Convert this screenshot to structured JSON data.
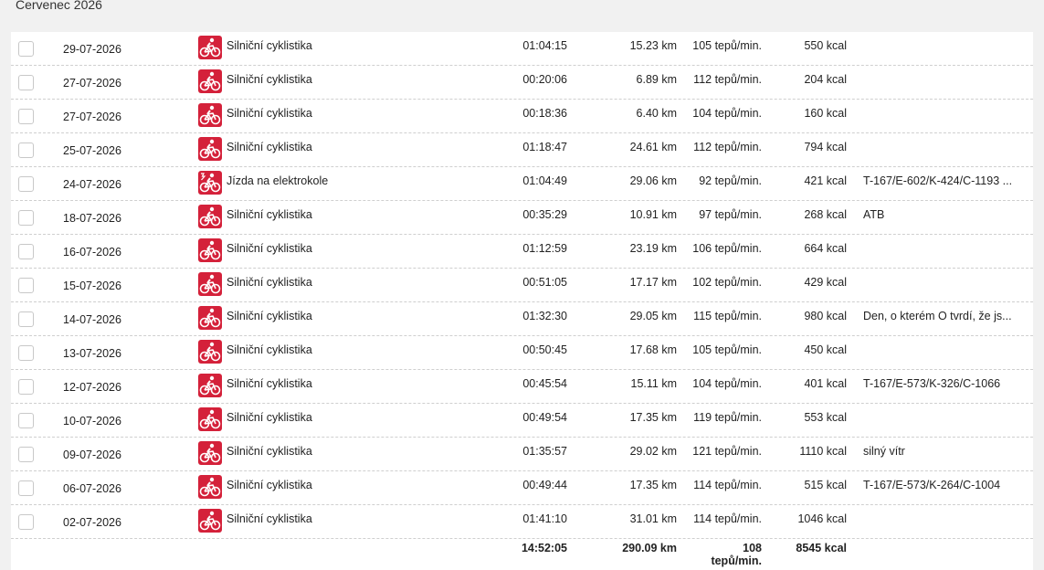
{
  "month_title": "Červenec 2026",
  "rows": [
    {
      "date": "29-07-2026",
      "sport": "Silniční cyklistika",
      "icon": "road-bike-icon",
      "time": "01:04:15",
      "distance": "15.23 km",
      "heart_rate": "105 tepů/min.",
      "kcal": "550 kcal",
      "note": ""
    },
    {
      "date": "27-07-2026",
      "sport": "Silniční cyklistika",
      "icon": "road-bike-icon",
      "time": "00:20:06",
      "distance": "6.89 km",
      "heart_rate": "112 tepů/min.",
      "kcal": "204 kcal",
      "note": ""
    },
    {
      "date": "27-07-2026",
      "sport": "Silniční cyklistika",
      "icon": "road-bike-icon",
      "time": "00:18:36",
      "distance": "6.40 km",
      "heart_rate": "104 tepů/min.",
      "kcal": "160 kcal",
      "note": ""
    },
    {
      "date": "25-07-2026",
      "sport": "Silniční cyklistika",
      "icon": "road-bike-icon",
      "time": "01:18:47",
      "distance": "24.61 km",
      "heart_rate": "112 tepů/min.",
      "kcal": "794 kcal",
      "note": ""
    },
    {
      "date": "24-07-2026",
      "sport": "Jízda na elektrokole",
      "icon": "e-bike-icon",
      "time": "01:04:49",
      "distance": "29.06 km",
      "heart_rate": "92 tepů/min.",
      "kcal": "421 kcal",
      "note": "T-167/E-602/K-424/C-1193 ..."
    },
    {
      "date": "18-07-2026",
      "sport": "Silniční cyklistika",
      "icon": "road-bike-icon",
      "time": "00:35:29",
      "distance": "10.91 km",
      "heart_rate": "97 tepů/min.",
      "kcal": "268 kcal",
      "note": "ATB"
    },
    {
      "date": "16-07-2026",
      "sport": "Silniční cyklistika",
      "icon": "road-bike-icon",
      "time": "01:12:59",
      "distance": "23.19 km",
      "heart_rate": "106 tepů/min.",
      "kcal": "664 kcal",
      "note": ""
    },
    {
      "date": "15-07-2026",
      "sport": "Silniční cyklistika",
      "icon": "road-bike-icon",
      "time": "00:51:05",
      "distance": "17.17 km",
      "heart_rate": "102 tepů/min.",
      "kcal": "429 kcal",
      "note": ""
    },
    {
      "date": "14-07-2026",
      "sport": "Silniční cyklistika",
      "icon": "road-bike-icon",
      "time": "01:32:30",
      "distance": "29.05 km",
      "heart_rate": "115 tepů/min.",
      "kcal": "980 kcal",
      "note": "Den, o kterém O tvrdí, že js..."
    },
    {
      "date": "13-07-2026",
      "sport": "Silniční cyklistika",
      "icon": "road-bike-icon",
      "time": "00:50:45",
      "distance": "17.68 km",
      "heart_rate": "105 tepů/min.",
      "kcal": "450 kcal",
      "note": ""
    },
    {
      "date": "12-07-2026",
      "sport": "Silniční cyklistika",
      "icon": "road-bike-icon",
      "time": "00:45:54",
      "distance": "15.11 km",
      "heart_rate": "104 tepů/min.",
      "kcal": "401 kcal",
      "note": "T-167/E-573/K-326/C-1066"
    },
    {
      "date": "10-07-2026",
      "sport": "Silniční cyklistika",
      "icon": "road-bike-icon",
      "time": "00:49:54",
      "distance": "17.35 km",
      "heart_rate": "119 tepů/min.",
      "kcal": "553 kcal",
      "note": ""
    },
    {
      "date": "09-07-2026",
      "sport": "Silniční cyklistika",
      "icon": "road-bike-icon",
      "time": "01:35:57",
      "distance": "29.02 km",
      "heart_rate": "121 tepů/min.",
      "kcal": "1110 kcal",
      "note": "silný vítr"
    },
    {
      "date": "06-07-2026",
      "sport": "Silniční cyklistika",
      "icon": "road-bike-icon",
      "time": "00:49:44",
      "distance": "17.35 km",
      "heart_rate": "114 tepů/min.",
      "kcal": "515 kcal",
      "note": "T-167/E-573/K-264/C-1004"
    },
    {
      "date": "02-07-2026",
      "sport": "Silniční cyklistika",
      "icon": "road-bike-icon",
      "time": "01:41:10",
      "distance": "31.01 km",
      "heart_rate": "114 tepů/min.",
      "kcal": "1046 kcal",
      "note": ""
    }
  ],
  "totals": {
    "time": "14:52:05",
    "distance": "290.09 km",
    "heart_rate": "108 tepů/min.",
    "kcal": "8545 kcal"
  },
  "colors": {
    "icon_bg": "#d4213a",
    "page_bg": "#f1f1f1",
    "table_bg": "#ffffff"
  }
}
